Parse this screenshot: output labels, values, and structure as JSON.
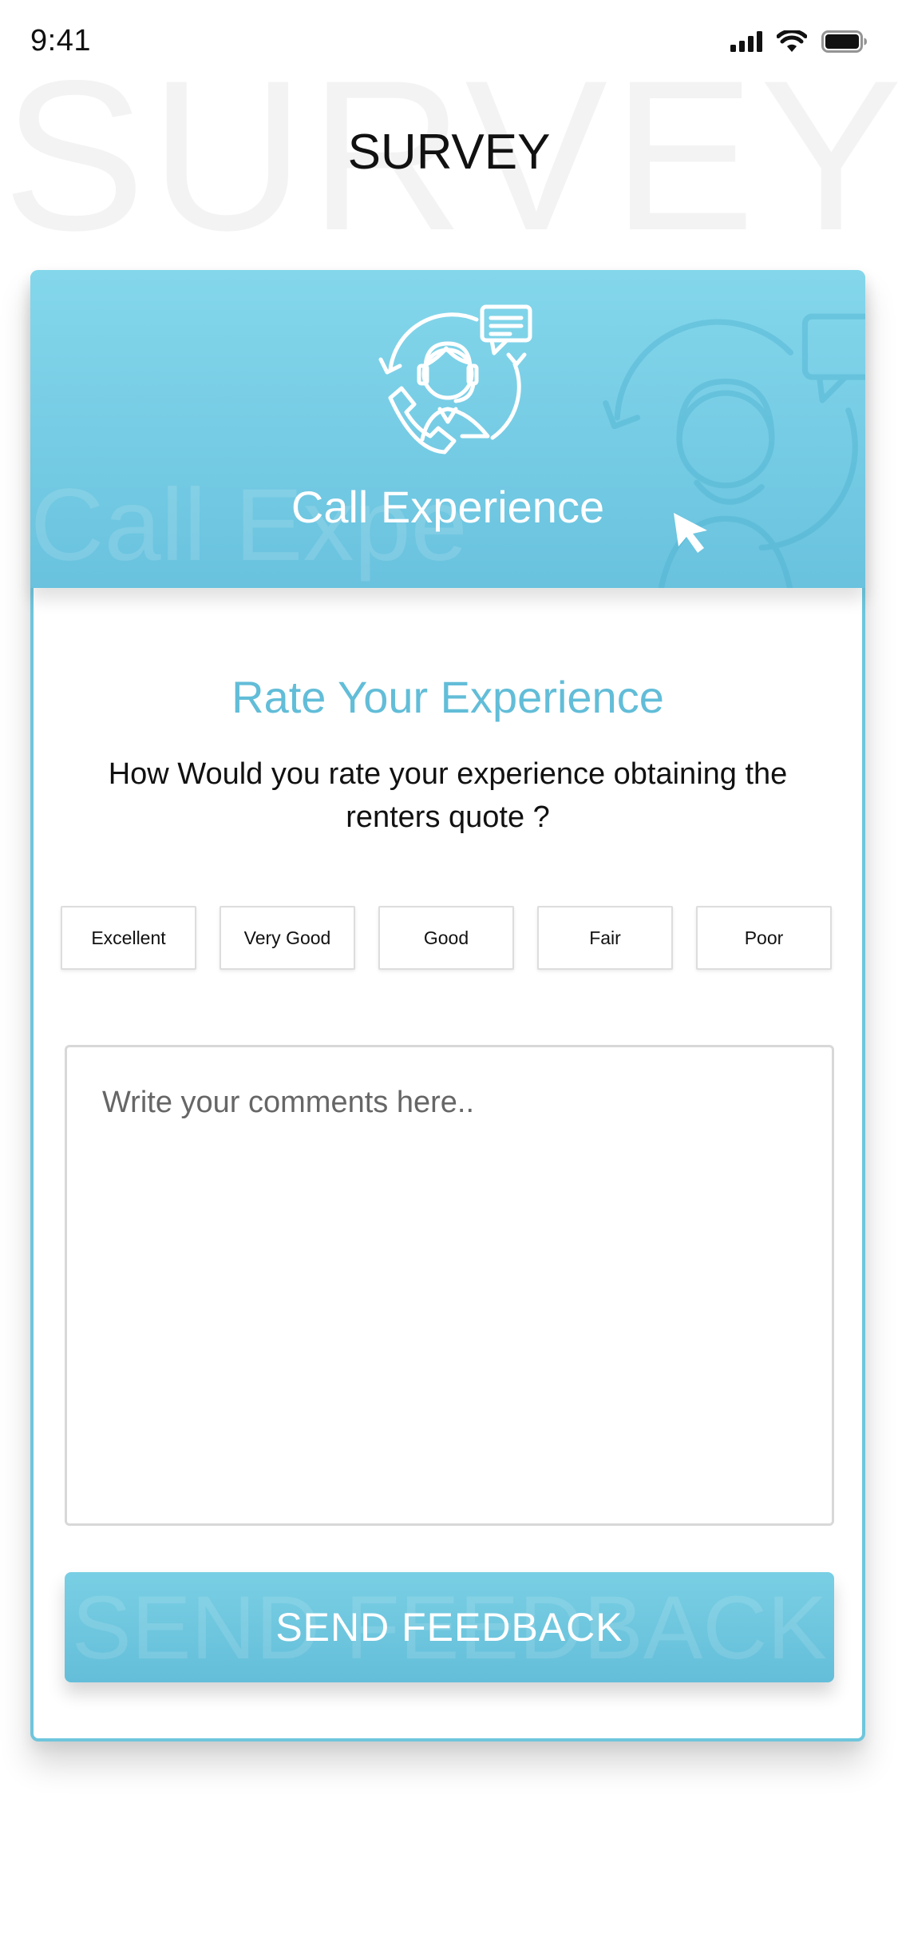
{
  "status_bar": {
    "time": "9:41",
    "icons": [
      "cellular-signal-icon",
      "wifi-icon",
      "battery-icon"
    ]
  },
  "header": {
    "background_text": "SURVEY",
    "title": "SURVEY"
  },
  "card": {
    "banner": {
      "title": "Call Experience",
      "background_text": "Call Expe",
      "icon": "call-center-agent-icon",
      "color_top": "#84d7eb",
      "color_bottom": "#69c2de"
    },
    "rate_title": "Rate Your Experience",
    "question": "How Would you rate your experience obtaining the renters quote ?",
    "rating_options": [
      {
        "label": "Excellent"
      },
      {
        "label": "Very Good"
      },
      {
        "label": "Good"
      },
      {
        "label": "Fair"
      },
      {
        "label": "Poor"
      }
    ],
    "comments": {
      "value": "",
      "placeholder": "Write your comments here.."
    },
    "send_button": {
      "label": "SEND FEEDBACK",
      "background_text": "SEND FEEDBACK"
    }
  },
  "colors": {
    "accent": "#62bdd8",
    "card_border": "#6ec6dc"
  }
}
